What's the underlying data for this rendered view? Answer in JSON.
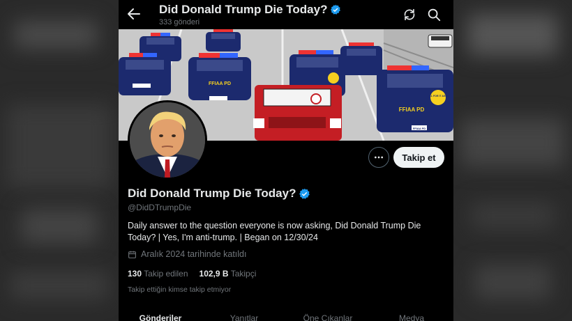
{
  "header": {
    "title": "Did Donald Trump Die Today?",
    "post_count": "333 gönderi"
  },
  "banner": {
    "car_label": "FFIAA PD",
    "badge_text": "FELL FOR IT AGAIN",
    "plate_text": "FFIAA PD"
  },
  "profile": {
    "name": "Did Donald Trump Die Today?",
    "handle": "@DidDTrumpDie",
    "bio": "Daily answer to the question everyone is now asking, Did Donald Trump Die Today? | Yes, I'm anti-trump. | Began on 12/30/24",
    "joined": "Aralık 2024 tarihinde katıldı",
    "following_count": "130",
    "following_label": "Takip edilen",
    "followers_count": "102,9 B",
    "followers_label": "Takipçi",
    "not_followed": "Takip ettiğin kimse takip etmiyor",
    "follow_button": "Takip et"
  },
  "tabs": [
    {
      "label": "Gönderiler"
    },
    {
      "label": "Yanıtlar"
    },
    {
      "label": "Öne Çıkanlar"
    },
    {
      "label": "Medya"
    }
  ],
  "colors": {
    "verified": "#1d9bf0",
    "background": "#000000",
    "muted": "#71767b",
    "police_car": "#1c2a6e",
    "truck": "#c41e24"
  }
}
